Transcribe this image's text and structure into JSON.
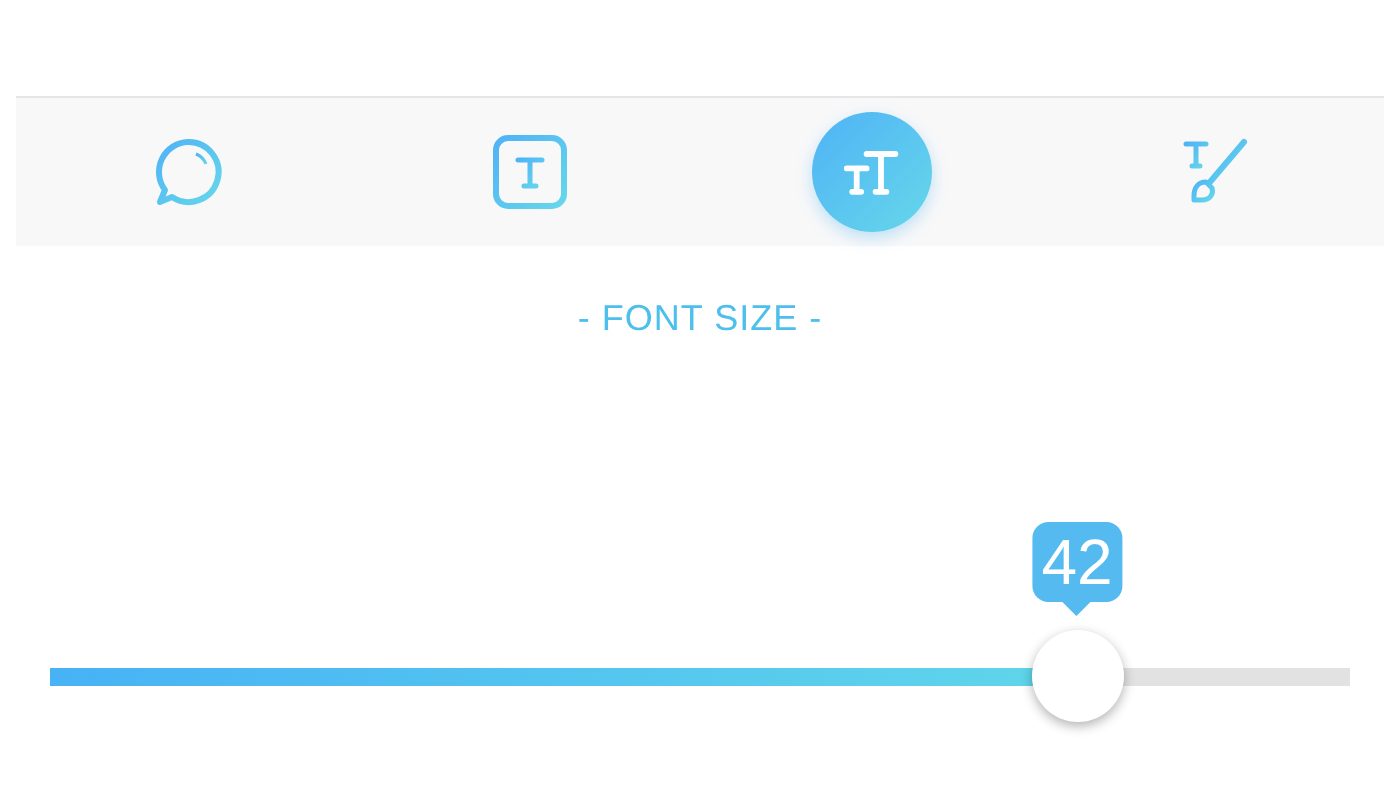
{
  "toolbar": {
    "tabs": [
      {
        "kind": "bubble",
        "selected": false
      },
      {
        "kind": "text-box",
        "selected": false
      },
      {
        "kind": "font-size",
        "selected": true
      },
      {
        "kind": "brush",
        "selected": false
      }
    ]
  },
  "section_title": "- FONT SIZE -",
  "slider": {
    "level": 0.79,
    "reading": "42"
  }
}
